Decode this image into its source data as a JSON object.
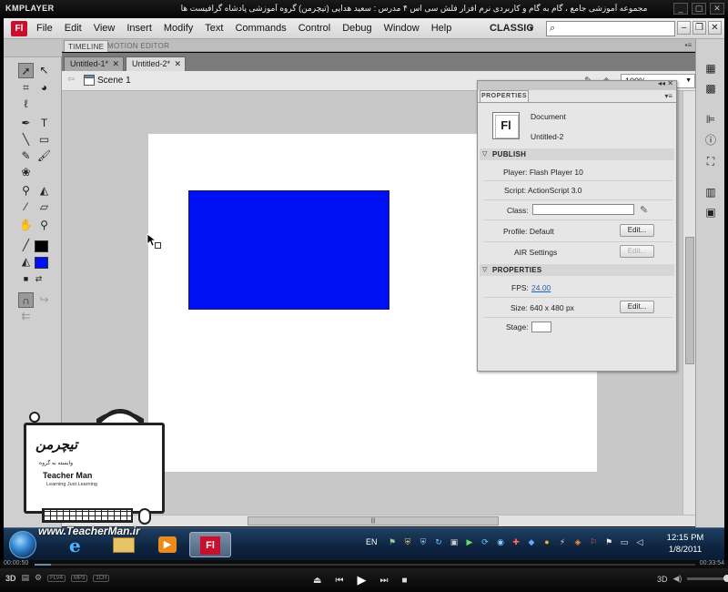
{
  "kmplayer": {
    "logo": "KMPLAYER",
    "caption": "مجموعه آموزشی جامع ، گام به گام و کاربردی نرم افزار فلش سی اس ۴ مدرس : سعید هدایی (تیچرمن) گروه آموزشی پادشاه گرافیست ها",
    "time_elapsed": "00:00:50",
    "time_total": "00:33:54",
    "progress_fraction": 0.025,
    "badges": [
      "FLV4",
      "MP3",
      "1CH"
    ],
    "label_3d": "3D"
  },
  "flash": {
    "app_icon": "Fl",
    "menu": [
      "File",
      "Edit",
      "View",
      "Insert",
      "Modify",
      "Text",
      "Commands",
      "Control",
      "Debug",
      "Window",
      "Help"
    ],
    "workspace": "CLASSIC",
    "search_placeholder": "",
    "timeline_tabs": [
      "TIMELINE",
      "MOTION EDITOR"
    ],
    "doc_tabs": [
      "Untitled-1*",
      "Untitled-2*"
    ],
    "scene_label": "Scene 1",
    "zoom": "100%"
  },
  "stage": {
    "rect_color": "#0010f5"
  },
  "properties": {
    "tab_label": "PROPERTIES",
    "doc_icon": "Fl",
    "type_label": "Document",
    "doc_name": "Untitled-2",
    "publish_header": "PUBLISH",
    "player": "Player: Flash Player 10",
    "script": "Script: ActionScript 3.0",
    "class_label": "Class:",
    "profile": "Profile: Default",
    "air": "AIR  Settings",
    "edit_btn": "Edit...",
    "props_header": "PROPERTIES",
    "fps_label": "FPS:",
    "fps_value": "24.00",
    "size": "Size:  640 x 480 px",
    "stage_label": "Stage:"
  },
  "overlay": {
    "logo_text": "تیچرمن",
    "sub_text": "وابسته به گروه",
    "brand_name": "Teacher Man",
    "tagline": "Learning Just Learning",
    "url": "www.TeacherMan.ir"
  },
  "taskbar": {
    "lang": "EN",
    "time": "12:15 PM",
    "date": "1/8/2011",
    "fl_icon": "Fl"
  }
}
